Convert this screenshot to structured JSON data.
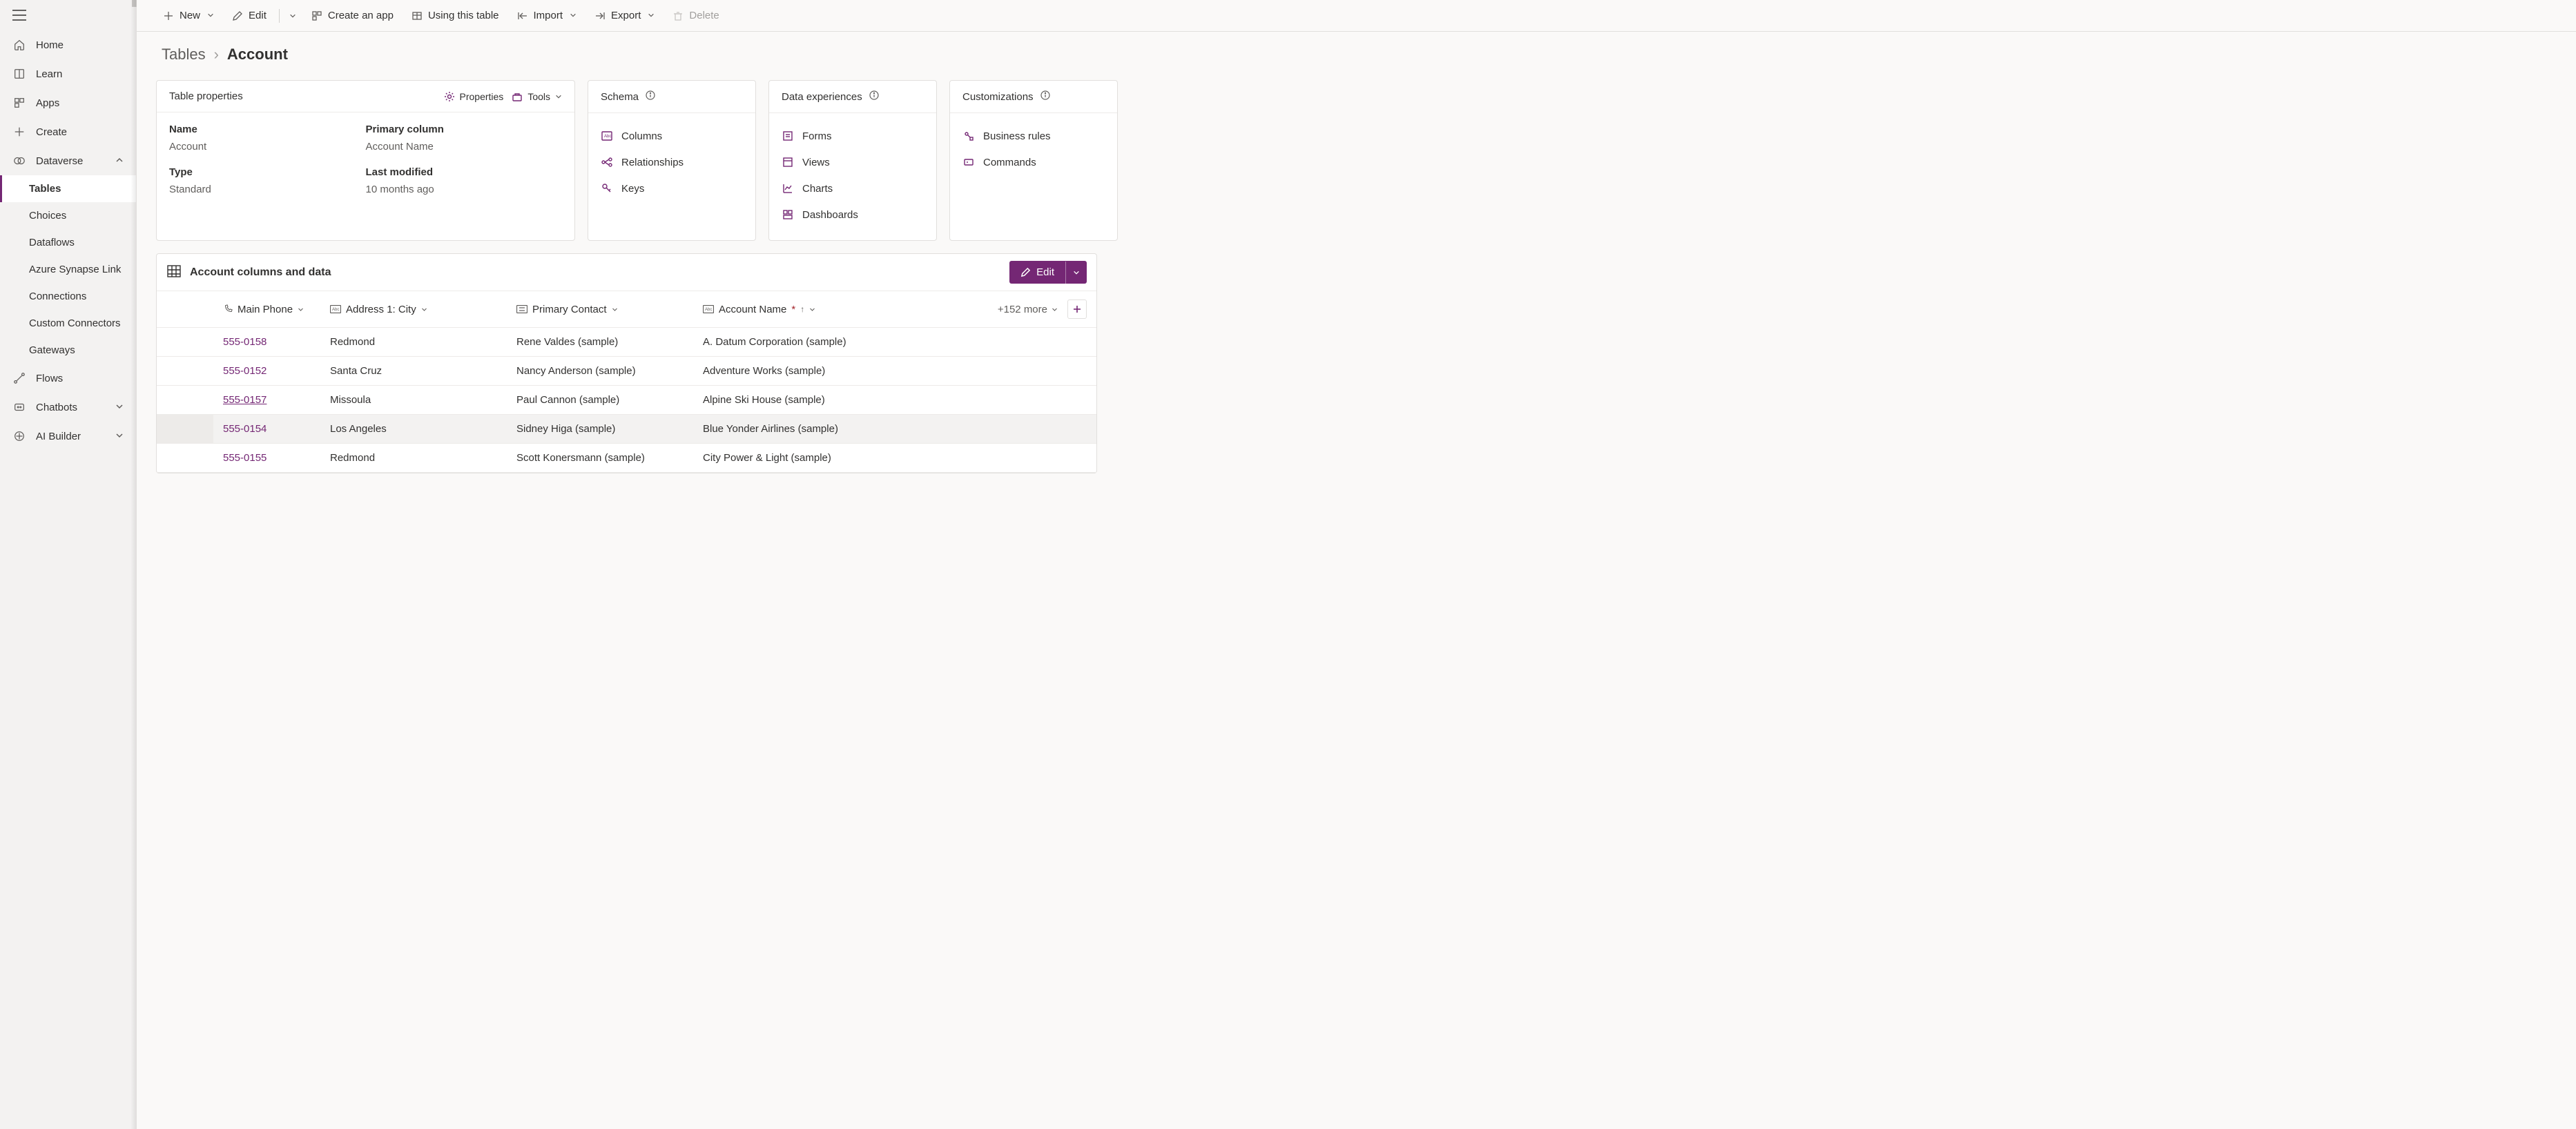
{
  "sidebar": {
    "items": [
      {
        "label": "Home"
      },
      {
        "label": "Learn"
      },
      {
        "label": "Apps"
      },
      {
        "label": "Create"
      },
      {
        "label": "Dataverse"
      }
    ],
    "dataverse_children": [
      {
        "label": "Tables"
      },
      {
        "label": "Choices"
      },
      {
        "label": "Dataflows"
      },
      {
        "label": "Azure Synapse Link"
      },
      {
        "label": "Connections"
      },
      {
        "label": "Custom Connectors"
      },
      {
        "label": "Gateways"
      }
    ],
    "tail_items": [
      {
        "label": "Flows"
      },
      {
        "label": "Chatbots"
      },
      {
        "label": "AI Builder"
      }
    ]
  },
  "cmdbar": {
    "new": "New",
    "edit": "Edit",
    "create_app": "Create an app",
    "using_table": "Using this table",
    "import": "Import",
    "export": "Export",
    "delete": "Delete"
  },
  "breadcrumb": {
    "parent": "Tables",
    "current": "Account"
  },
  "cards": {
    "props": {
      "title": "Table properties",
      "action_properties": "Properties",
      "action_tools": "Tools",
      "labels": {
        "name": "Name",
        "primary": "Primary column",
        "type": "Type",
        "modified": "Last modified"
      },
      "values": {
        "name": "Account",
        "primary": "Account Name",
        "type": "Standard",
        "modified": "10 months ago"
      }
    },
    "schema": {
      "title": "Schema",
      "links": [
        "Columns",
        "Relationships",
        "Keys"
      ]
    },
    "data_exp": {
      "title": "Data experiences",
      "links": [
        "Forms",
        "Views",
        "Charts",
        "Dashboards"
      ]
    },
    "custom": {
      "title": "Customizations",
      "links": [
        "Business rules",
        "Commands"
      ]
    }
  },
  "data_section": {
    "title": "Account columns and data",
    "edit_label": "Edit",
    "more_label": "+152 more",
    "columns": {
      "phone": "Main Phone",
      "city": "Address 1: City",
      "contact": "Primary Contact",
      "account": "Account Name"
    },
    "rows": [
      {
        "phone": "555-0158",
        "city": "Redmond",
        "contact": "Rene Valdes (sample)",
        "account": "A. Datum Corporation (sample)"
      },
      {
        "phone": "555-0152",
        "city": "Santa Cruz",
        "contact": "Nancy Anderson (sample)",
        "account": "Adventure Works (sample)"
      },
      {
        "phone": "555-0157",
        "city": "Missoula",
        "contact": "Paul Cannon (sample)",
        "account": "Alpine Ski House (sample)"
      },
      {
        "phone": "555-0154",
        "city": "Los Angeles",
        "contact": "Sidney Higa (sample)",
        "account": "Blue Yonder Airlines (sample)"
      },
      {
        "phone": "555-0155",
        "city": "Redmond",
        "contact": "Scott Konersmann (sample)",
        "account": "City Power & Light (sample)"
      }
    ]
  }
}
